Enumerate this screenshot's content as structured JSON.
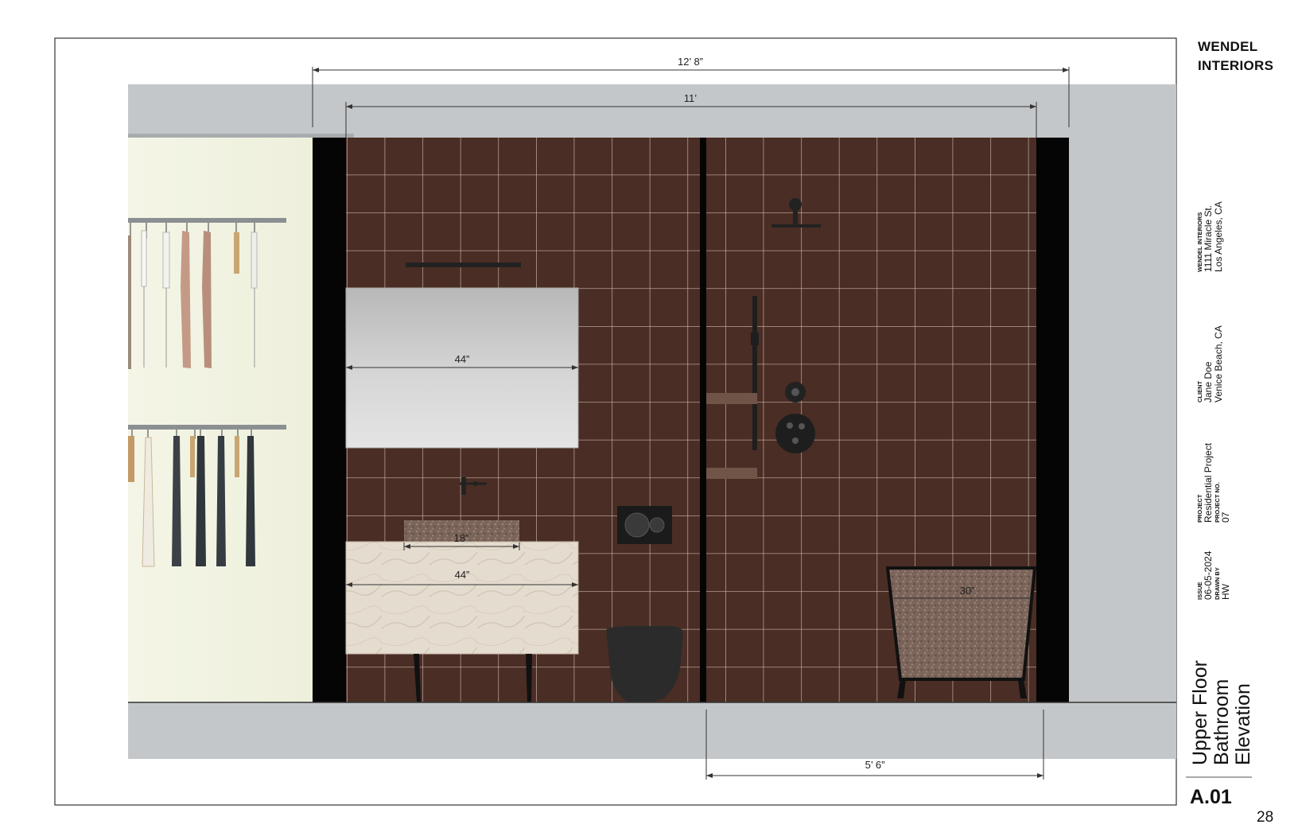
{
  "title_block": {
    "brand_line1": "WENDEL",
    "brand_line2": "INTERIORS",
    "firm": {
      "name": "WENDEL INTERIORS",
      "address": "1111 Miracle St.",
      "city": "Los Angeles, CA"
    },
    "client": {
      "label": "CLIENT",
      "name": "Jane Doe",
      "location": "Venice Beach, CA"
    },
    "project": {
      "label": "PROJECT",
      "name": "Residential Project",
      "no_label": "PROJECT NO.",
      "no": "07"
    },
    "issue": {
      "label": "ISSUE",
      "date": "06-05-2024",
      "drawn_label": "DRAWN BY",
      "drawn": "HW"
    },
    "sheet_title": {
      "line1": "Upper Floor",
      "line2": "Bathroom",
      "line3": "Elevation"
    },
    "sheet_number": "A.01",
    "page_number": "28"
  },
  "dimensions": {
    "overall_width": "12’ 8”",
    "interior_width": "11’",
    "mirror_width": "44”",
    "sink_width": "18”",
    "vanity_width": "44”",
    "tub_width": "30”",
    "shower_width": "5’ 6”"
  },
  "colors": {
    "tile": "#4a2d24",
    "grout": "#c9b7ae",
    "wall_gray": "#c4c7c9",
    "closet_wall": "#f1f2e2",
    "black": "#050505",
    "mirror": "#c9c9c9",
    "marble": "#e2d9cb",
    "stone": "#7a6258"
  }
}
